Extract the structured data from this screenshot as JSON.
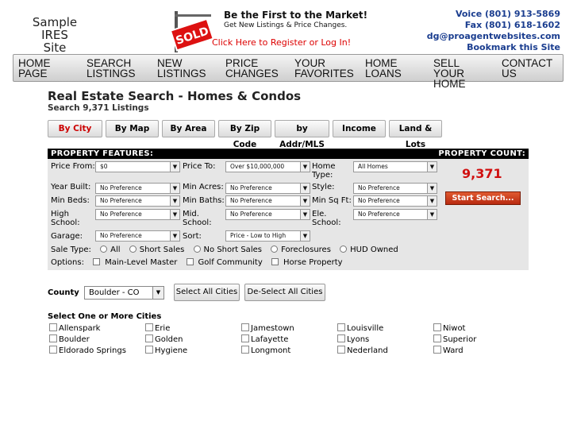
{
  "header": {
    "logo_line1": "Sample",
    "logo_line2": "IRES Site",
    "promo": {
      "sign_text": "SOLD",
      "headline": "Be the First to the Market!",
      "subline": "Get New Listings & Price Changes.",
      "cta": "Click Here to Register or Log In!"
    },
    "contact": {
      "voice": "Voice (801) 913-5869",
      "fax": "Fax (801) 618-1602",
      "email": "dg@proagentwebsites.com",
      "bookmark": "Bookmark this Site"
    }
  },
  "nav": {
    "items": [
      {
        "line1": "HOME",
        "line2": "PAGE"
      },
      {
        "line1": "SEARCH",
        "line2": "LISTINGS"
      },
      {
        "line1": "NEW",
        "line2": "LISTINGS"
      },
      {
        "line1": "PRICE",
        "line2": "CHANGES"
      },
      {
        "line1": "YOUR",
        "line2": "FAVORITES"
      },
      {
        "line1": "HOME",
        "line2": "LOANS"
      },
      {
        "line1": "SELL",
        "line2": "YOUR HOME"
      },
      {
        "line1": "CONTACT",
        "line2": "US"
      }
    ]
  },
  "page": {
    "title": "Real Estate Search - Homes & Condos",
    "subtitle": "Search 9,371 Listings"
  },
  "tabs": [
    "By City",
    "By Map",
    "By Area",
    "By Zip Code",
    "by Addr/MLS",
    "Income",
    "Land & Lots"
  ],
  "features": {
    "header_left": "PROPERTY FEATURES:",
    "header_right": "PROPERTY COUNT:",
    "count": "9,371",
    "start_button": "Start Search...",
    "labels": {
      "price_from": "Price From:",
      "price_to": "Price To:",
      "home_type": "Home Type:",
      "year_built": "Year Built:",
      "min_acres": "Min Acres:",
      "style": "Style:",
      "min_beds": "Min Beds:",
      "min_baths": "Min Baths:",
      "min_sqft": "Min Sq Ft:",
      "high_school": "High School:",
      "mid_school": "Mid. School:",
      "ele_school": "Ele. School:",
      "garage": "Garage:",
      "sort": "Sort:",
      "sale_type": "Sale Type:",
      "options": "Options:"
    },
    "values": {
      "price_from": "$0",
      "price_to": "Over $10,000,000",
      "home_type": "All Homes",
      "year_built": "No Preference",
      "min_acres": "No Preference",
      "style": "No Preference",
      "min_beds": "No Preference",
      "min_baths": "No Preference",
      "min_sqft": "No Preference",
      "high_school": "No Preference",
      "mid_school": "No Preference",
      "ele_school": "No Preference",
      "garage": "No Preference",
      "sort": "Price - Low to High"
    },
    "sale_types": [
      "All",
      "Short Sales",
      "No Short Sales",
      "Foreclosures",
      "HUD Owned"
    ],
    "options": [
      "Main-Level Master",
      "Golf Community",
      "Horse Property"
    ]
  },
  "county": {
    "label": "County",
    "value": "Boulder - CO",
    "select_all": "Select All Cities",
    "deselect_all": "De-Select All Cities"
  },
  "cities": {
    "heading": "Select One or More Cities",
    "list": [
      "Allenspark",
      "Erie",
      "Jamestown",
      "Louisville",
      "Niwot",
      "Boulder",
      "Golden",
      "Lafayette",
      "Lyons",
      "Superior",
      "Eldorado Springs",
      "Hygiene",
      "Longmont",
      "Nederland",
      "Ward"
    ]
  }
}
